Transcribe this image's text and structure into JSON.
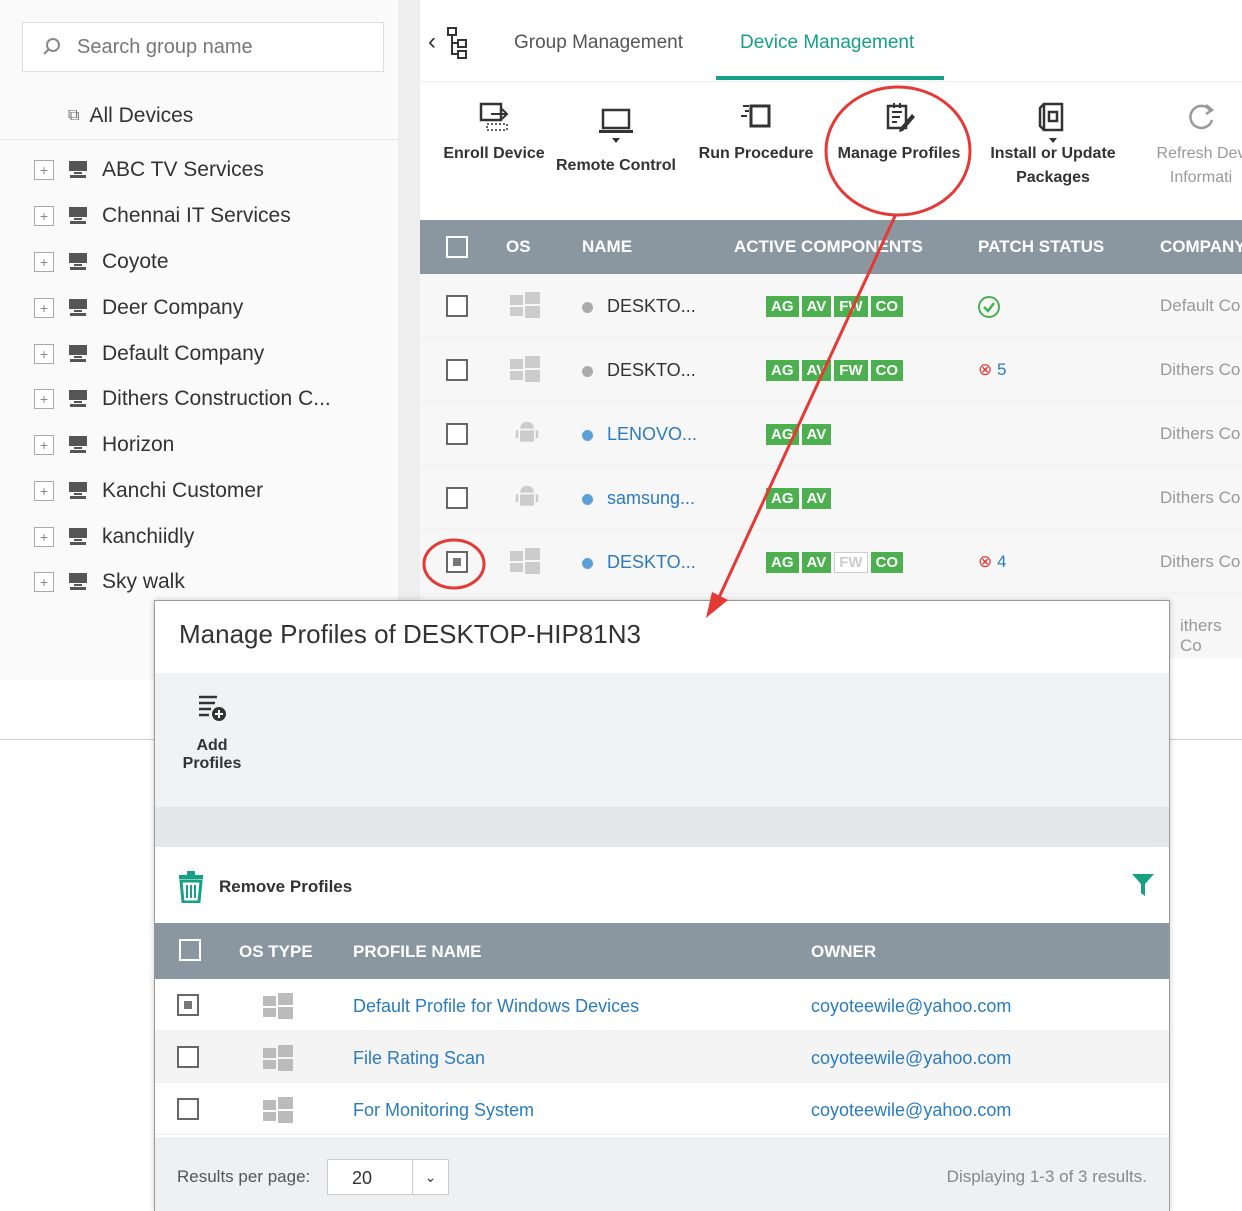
{
  "sidebar": {
    "search_placeholder": "Search group name",
    "all_devices": "All Devices",
    "groups": [
      "ABC TV Services",
      "Chennai IT Services",
      "Coyote",
      "Deer Company",
      "Default Company",
      "Dithers Construction C...",
      "Horizon",
      "Kanchi Customer",
      "kanchiidly",
      "Sky walk"
    ]
  },
  "tabs": {
    "group": "Group Management",
    "device": "Device Management"
  },
  "toolbar": {
    "enroll": "Enroll Device",
    "remote": "Remote Control",
    "run": "Run Procedure",
    "manage": "Manage Profiles",
    "install_l1": "Install or Update",
    "install_l2": "Packages",
    "refresh_l1": "Refresh Dev",
    "refresh_l2": "Informati"
  },
  "grid": {
    "headers": {
      "os": "OS",
      "name": "NAME",
      "active": "ACTIVE COMPONENTS",
      "patch": "PATCH STATUS",
      "company": "COMPANY"
    },
    "rows": [
      {
        "name": "DESKTO...",
        "badges": [
          "AG",
          "AV",
          "FW",
          "CO"
        ],
        "patch": "",
        "company": "Default Co"
      },
      {
        "name": "DESKTO...",
        "badges": [
          "AG",
          "AV",
          "FW",
          "CO"
        ],
        "patch": "5",
        "company": "Dithers Co"
      },
      {
        "name": "LENOVO...",
        "badges": [
          "AG",
          "AV"
        ],
        "patch": "",
        "company": "Dithers Co"
      },
      {
        "name": "samsung...",
        "badges": [
          "AG",
          "AV"
        ],
        "patch": "",
        "company": "Dithers Co"
      },
      {
        "name": "DESKTO...",
        "badges": [
          "AG",
          "AV",
          "FW",
          "CO"
        ],
        "patch": "4",
        "company": "Dithers Co"
      },
      {
        "company": "ithers Co"
      }
    ]
  },
  "dialog": {
    "title": "Manage Profiles of DESKTOP-HIP81N3",
    "add_profiles": "Add Profiles",
    "remove_profiles": "Remove Profiles",
    "headers": {
      "os_type": "OS TYPE",
      "profile_name": "PROFILE NAME",
      "owner": "OWNER"
    },
    "rows": [
      {
        "profile": "Default Profile for Windows Devices",
        "owner": "coyoteewile@yahoo.com"
      },
      {
        "profile": "File Rating Scan",
        "owner": "coyoteewile@yahoo.com"
      },
      {
        "profile": "For Monitoring System",
        "owner": "coyoteewile@yahoo.com"
      }
    ],
    "results_label": "Results per page:",
    "results_value": "20",
    "displaying": "Displaying 1-3 of 3 results."
  },
  "colors": {
    "accent": "#16a085",
    "header": "#8a96a0",
    "badge": "#4caf50",
    "annotation": "#e53935",
    "link": "#2a7bbf"
  }
}
